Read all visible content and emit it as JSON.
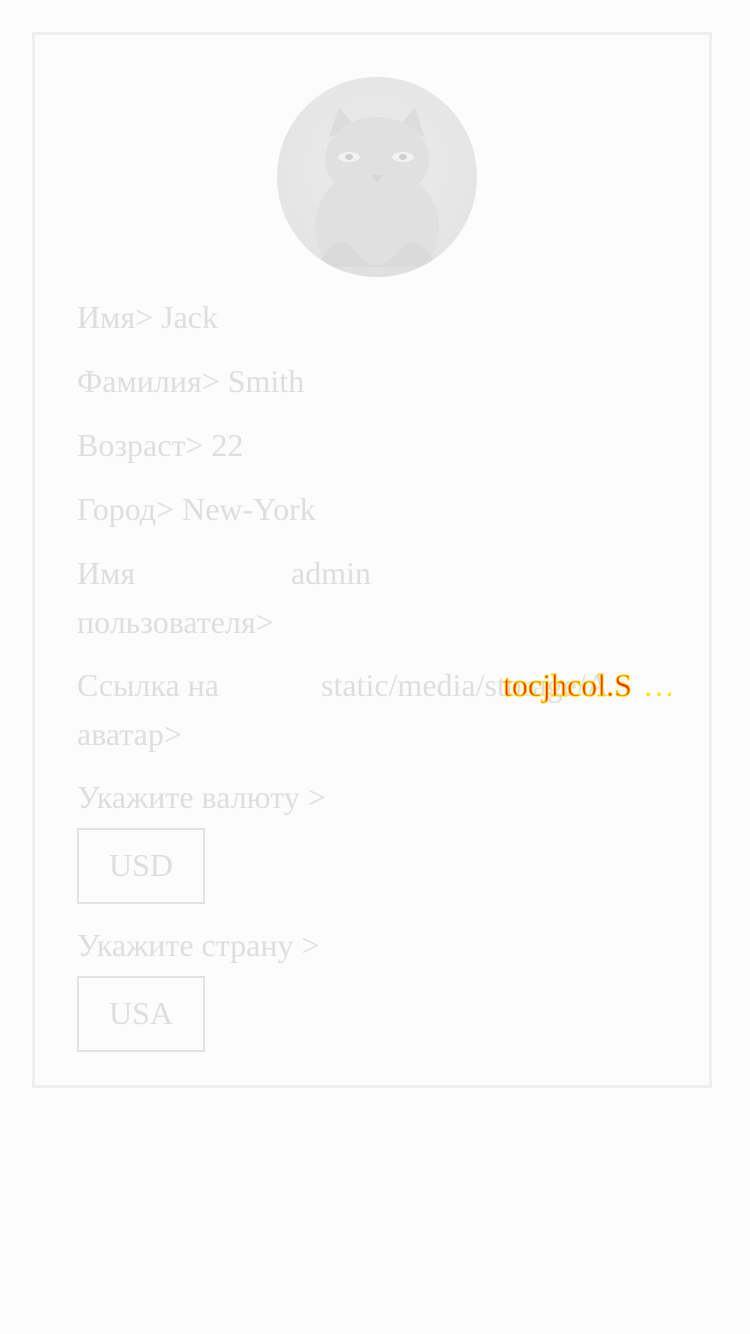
{
  "profile": {
    "avatar_alt": "cat-avatar",
    "first_name_label": "Имя>",
    "first_name": "Jack",
    "last_name_label": "Фамилия>",
    "last_name": "Smith",
    "age_label": "Возраст>",
    "age": "22",
    "city_label": "Город>",
    "city": "New-York",
    "username_label": "Имя пользователя>",
    "username": "admin",
    "avatar_link_label": "Ссылка на аватар>",
    "avatar_link": "static/media/storage/A",
    "avatar_link_overlay": "tocjhcol.S",
    "avatar_link_ellipsis": "…"
  },
  "currency": {
    "label": "Укажите валюту >",
    "value": "USD"
  },
  "country": {
    "label": "Укажите страну >",
    "value": "USA"
  }
}
